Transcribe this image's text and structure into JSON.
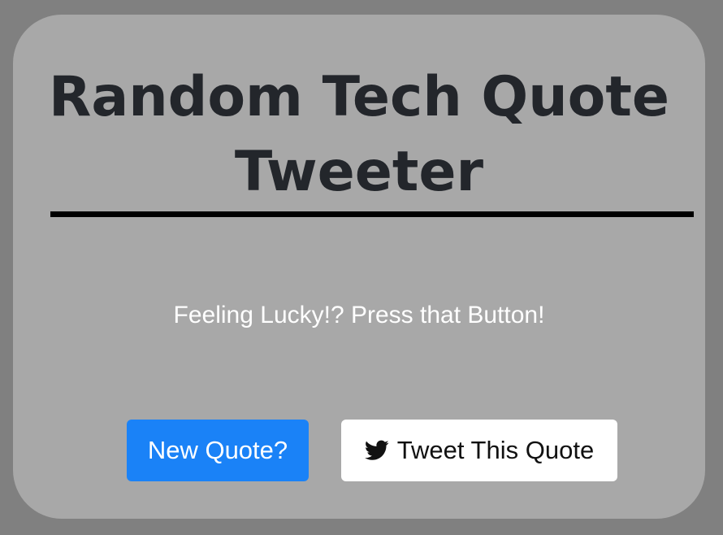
{
  "page": {
    "title": "Random Tech Quote Tweeter",
    "title_line1": "Random Tech Quote",
    "title_line2": "Tweeter",
    "prompt": "Feeling Lucky!? Press that Button!"
  },
  "buttons": {
    "new_quote_label": "New Quote?",
    "tweet_label": "Tweet This Quote",
    "tweet_icon": "twitter-bird-icon"
  },
  "colors": {
    "page_background": "#808080",
    "card_background": "#a8a8a8",
    "title_text": "#23262b",
    "primary_button": "#1a82f7",
    "tweet_button": "#ffffff",
    "prompt_text": "#ffffff"
  }
}
